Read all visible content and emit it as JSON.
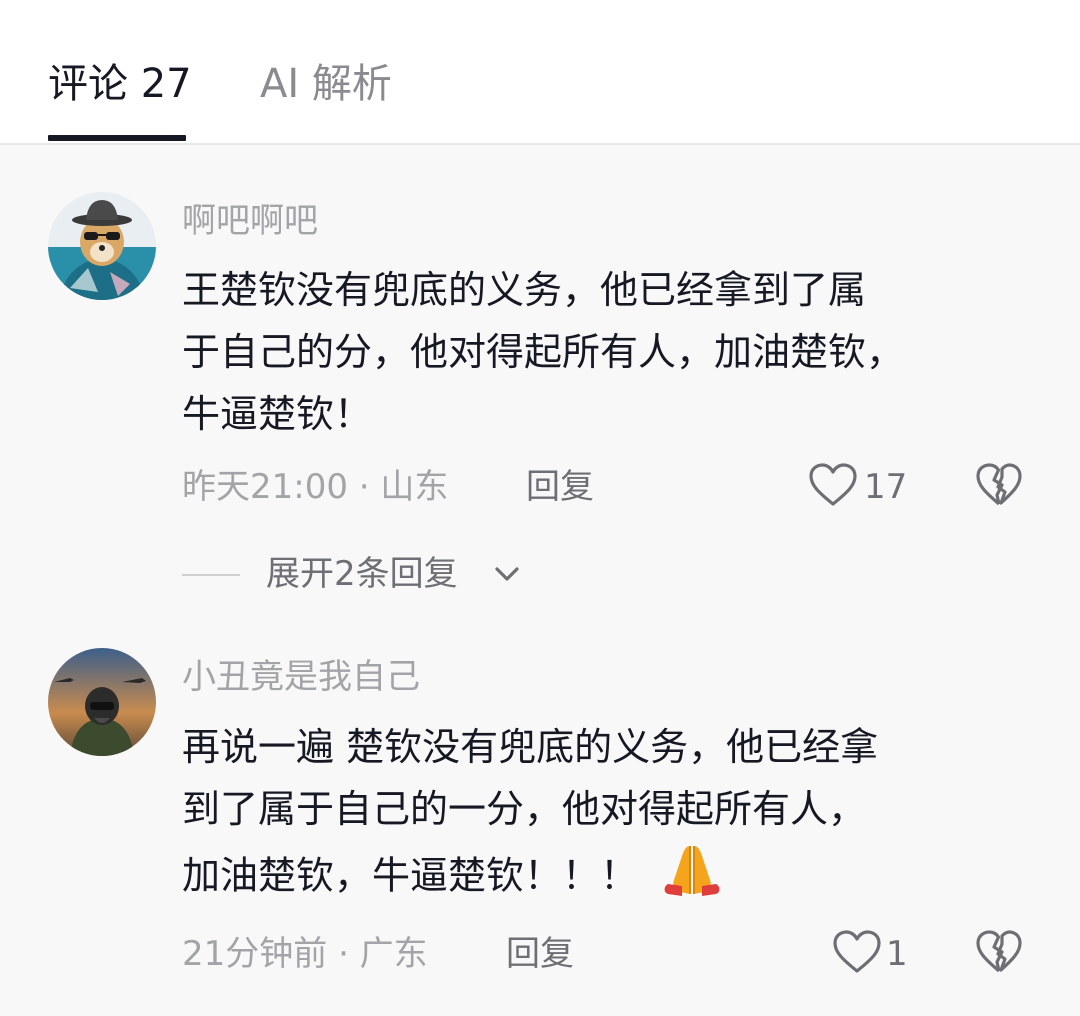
{
  "tabs": [
    {
      "label": "评论 27",
      "active": true
    },
    {
      "label": "AI 解析",
      "active": false
    }
  ],
  "comments": [
    {
      "username": "啊吧啊吧",
      "text_lines": [
        "王楚钦没有兜底的义务，他已经拿到了属",
        "于自己的分，他对得起所有人，加油楚钦，",
        "牛逼楚钦！"
      ],
      "meta": "昨天21:00 · 山东",
      "reply_label": "回复",
      "likes": "17",
      "expand_label": "展开2条回复",
      "avatar_icon": "dog-with-sunglasses-avatar"
    },
    {
      "username": "小丑竟是我自己",
      "text_lines": [
        "再说一遍 楚钦没有兜底的义务，他已经拿",
        "到了属于自己的一分，他对得起所有人，",
        "加油楚钦，牛逼楚钦！！！"
      ],
      "emoji": "folded-hands-icon",
      "meta": "21分钟前 · 广东",
      "reply_label": "回复",
      "likes": "1",
      "avatar_icon": "fighter-pilot-avatar"
    }
  ],
  "colors": {
    "background": "#f8f8f8",
    "primary_text": "#161823",
    "secondary_text": "#a3a4a8",
    "action_text": "#6e6f75"
  }
}
